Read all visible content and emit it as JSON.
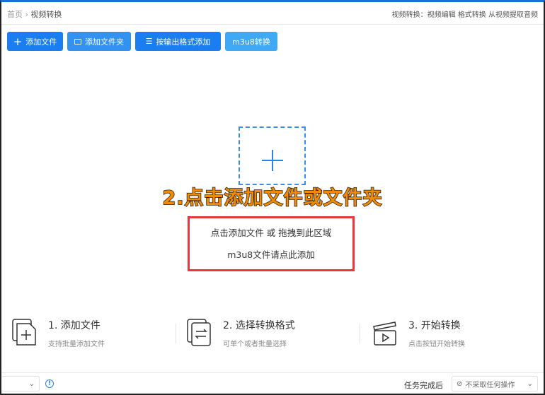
{
  "breadcrumb": {
    "home": "首页",
    "separator": "›",
    "current": "视频转换"
  },
  "top_links": {
    "label": "视频转换：",
    "items": [
      "视频编辑",
      "格式转换",
      "从视频提取音频"
    ]
  },
  "toolbar": {
    "add_file": "添加文件",
    "add_folder": "添加文件夹",
    "add_by_format": "按输出格式添加",
    "m3u8": "m3u8转换"
  },
  "annotation": "2.点击添加文件或文件夹",
  "dropzone": {
    "line1": "点击添加文件 或 拖拽到此区域",
    "line2": "m3u8文件请点此添加"
  },
  "steps": [
    {
      "title": "1. 添加文件",
      "sub": "支持批量添加文件"
    },
    {
      "title": "2. 选择转换格式",
      "sub": "可单个或者批量选择"
    },
    {
      "title": "3. 开始转换",
      "sub": "点击按钮开始转换"
    }
  ],
  "footer": {
    "after_label": "任务完成后",
    "after_value": "不采取任何操作"
  },
  "colors": {
    "primary": "#1a7ef0",
    "light": "#3fa9f5",
    "annotation": "#f28a00",
    "highlight": "#e8363a"
  }
}
